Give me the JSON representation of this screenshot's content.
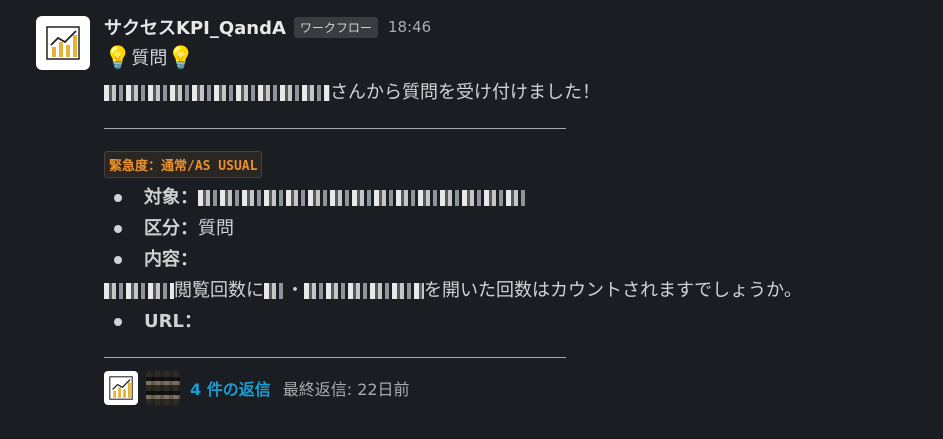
{
  "message": {
    "app_name": "サクセスKPI_QandA",
    "badge": "ワークフロー",
    "time": "18:46",
    "title_bulb": "💡",
    "title": "質問",
    "intro_suffix": "さんから質問を受け付けました！",
    "urgency": "緊急度：通常/AS USUAL",
    "items": [
      {
        "label": "対象：",
        "value": ""
      },
      {
        "label": "区分：",
        "value": "質問"
      },
      {
        "label": "内容：",
        "value": ""
      }
    ],
    "content_text_mid": "閲覧回数に",
    "content_text_dot": "・",
    "content_text_end": "を開いた回数はカウントされますでしょうか。",
    "url_label": "URL：",
    "thread": {
      "reply_count": "4 件の返信",
      "last_reply": "最終返信: 22日前"
    }
  },
  "icons": {
    "app_avatar": "bar-chart-icon",
    "user_avatar": "user-avatar"
  }
}
